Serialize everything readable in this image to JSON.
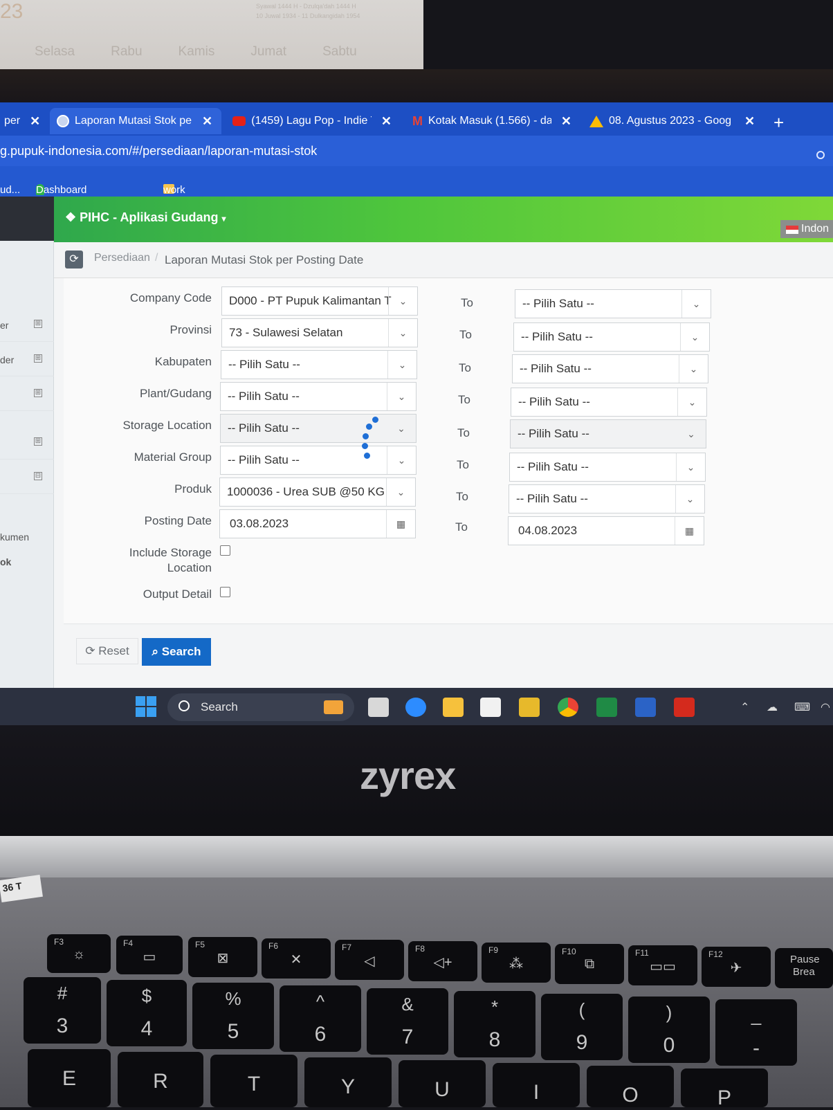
{
  "calendar": {
    "notes": [
      "Syawal 1444 H - Dzulqa'dah 1444 H",
      "10 Juwal 1934 - 11 Dulkangidah 1954"
    ],
    "days": [
      "Selasa",
      "Rabu",
      "Kamis",
      "Jumat",
      "Sabtu"
    ]
  },
  "browser": {
    "tabs": [
      {
        "title": "per",
        "icon": "generic-tab-icon"
      },
      {
        "title": "Laporan Mutasi Stok per",
        "icon": "globe-icon",
        "active": true
      },
      {
        "title": "(1459) Lagu Pop - Indie T",
        "icon": "youtube-icon"
      },
      {
        "title": "Kotak Masuk (1.566) - da",
        "icon": "gmail-icon"
      },
      {
        "title": "08. Agustus 2023 - Goog",
        "icon": "google-drive-icon"
      }
    ],
    "url": "g.pupuk-indonesia.com/#/persediaan/laporan-mutasi-stok",
    "bookmarks": [
      {
        "label": "ud...",
        "icon": "bookmark-icon"
      },
      {
        "label": "Dashboard - Petro...",
        "icon": "petro-icon"
      },
      {
        "label": "work",
        "icon": "folder-icon"
      }
    ]
  },
  "app": {
    "title": "PIHC - Aplikasi Gudang",
    "language": "Indon",
    "breadcrumb": [
      "Persediaan",
      "Laporan Mutasi Stok per Posting Date"
    ],
    "sidebar": [
      {
        "label": "er",
        "toggle": "⊞"
      },
      {
        "label": "der",
        "toggle": "⊞"
      },
      {
        "label": "",
        "toggle": "⊞"
      },
      {
        "label": "",
        "toggle": "⊞"
      },
      {
        "label": "",
        "toggle": "⊟"
      },
      {
        "label": "kumen",
        "toggle": ""
      },
      {
        "label": "ok",
        "toggle": ""
      }
    ],
    "form": {
      "to_label": "To",
      "rows": [
        {
          "label": "Company Code",
          "from": "D000 - PT Pupuk Kalimantan T",
          "to": "-- Pilih Satu --",
          "type": "select"
        },
        {
          "label": "Provinsi",
          "from": "73 - Sulawesi Selatan",
          "to": "-- Pilih Satu --",
          "type": "select"
        },
        {
          "label": "Kabupaten",
          "from": "-- Pilih Satu --",
          "to": "-- Pilih Satu --",
          "type": "select"
        },
        {
          "label": "Plant/Gudang",
          "from": "-- Pilih Satu --",
          "to": "-- Pilih Satu --",
          "type": "select"
        },
        {
          "label": "Storage Location",
          "from": "-- Pilih Satu --",
          "to": "-- Pilih Satu --",
          "type": "select"
        },
        {
          "label": "Material Group",
          "from": "-- Pilih Satu --",
          "to": "-- Pilih Satu --",
          "type": "select"
        },
        {
          "label": "Produk",
          "from": "1000036 - Urea SUB @50 KG",
          "to": "-- Pilih Satu --",
          "type": "select"
        },
        {
          "label": "Posting Date",
          "from": "03.08.2023",
          "to": "04.08.2023",
          "type": "date"
        }
      ],
      "include_storage_label_1": "Include Storage",
      "include_storage_label_2": "Location",
      "include_storage_checked": false,
      "output_detail_label": "Output Detail",
      "output_detail_checked": false,
      "reset_label": "Reset",
      "search_label": "Search"
    }
  },
  "taskbar": {
    "search_label": "Search",
    "apps": [
      "widgets-icon",
      "task-view-icon",
      "zoom-icon",
      "file-explorer-icon",
      "microsoft-store-icon",
      "sticky-folder-icon",
      "chrome-icon",
      "excel-icon",
      "word-icon",
      "acrobat-icon"
    ]
  },
  "laptop": {
    "brand": "zyrex",
    "keys_fn": [
      "F3",
      "F4",
      "F5",
      "F6",
      "F7",
      "F8",
      "F9",
      "F10",
      "F11",
      "F12"
    ],
    "pause_label_1": "Pause",
    "pause_label_2": "Brea",
    "sticker_text": "36 T",
    "keys_num": [
      {
        "top": "#",
        "bot": "3"
      },
      {
        "top": "$",
        "bot": "4"
      },
      {
        "top": "%",
        "bot": "5"
      },
      {
        "top": "^",
        "bot": "6"
      },
      {
        "top": "&",
        "bot": "7"
      },
      {
        "top": "*",
        "bot": "8"
      },
      {
        "top": "(",
        "bot": "9"
      },
      {
        "top": ")",
        "bot": "0"
      },
      {
        "top": "_",
        "bot": "-"
      }
    ],
    "keys_alpha": [
      "E",
      "R",
      "T",
      "Y",
      "U",
      "I",
      "O",
      "P"
    ]
  }
}
